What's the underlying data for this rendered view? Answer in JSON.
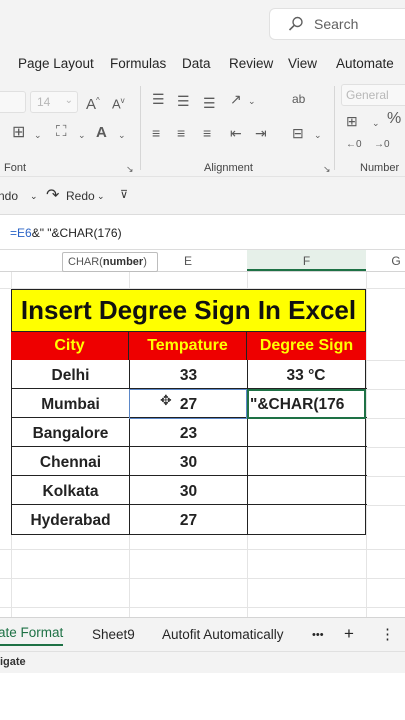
{
  "search": {
    "placeholder": "Search"
  },
  "menu_tabs": [
    "Page Layout",
    "Formulas",
    "Data",
    "Review",
    "View",
    "Automate"
  ],
  "ribbon": {
    "font_size": "14",
    "number_format": "General",
    "groups": {
      "font": "Font",
      "alignment": "Alignment",
      "number": "Number"
    }
  },
  "qat": {
    "undo": "ndo",
    "redo": "Redo"
  },
  "formula_bar": {
    "ref": "=E6",
    "rest": "&\" \"&CHAR(176)"
  },
  "tooltip": {
    "fn": "CHAR(",
    "arg": "number",
    "close": ")"
  },
  "columns": {
    "e": "E",
    "f": "F",
    "g": "G"
  },
  "table": {
    "title": "Insert Degree Sign In Excel",
    "headers": [
      "City",
      "Tempature",
      "Degree Sign"
    ],
    "rows": [
      {
        "city": "Delhi",
        "temp": "33",
        "deg": "33 °C"
      },
      {
        "city": "Mumbai",
        "temp": "27",
        "deg": "\"&CHAR(176"
      },
      {
        "city": "Bangalore",
        "temp": "23",
        "deg": ""
      },
      {
        "city": "Chennai",
        "temp": "30",
        "deg": ""
      },
      {
        "city": "Kolkata",
        "temp": "30",
        "deg": ""
      },
      {
        "city": "Hyderabad",
        "temp": "27",
        "deg": ""
      }
    ]
  },
  "sheet_tabs": {
    "active": "ate Format",
    "tab2": "Sheet9",
    "tab3": "Autofit Automatically",
    "more": "•••",
    "add": "+",
    "menu": "⋮"
  },
  "status": {
    "text": "igate"
  },
  "colors": {
    "title_bg": "#ffff00",
    "header_bg": "#ee0000",
    "header_text": "#ffff00",
    "accent": "#1e7145"
  }
}
